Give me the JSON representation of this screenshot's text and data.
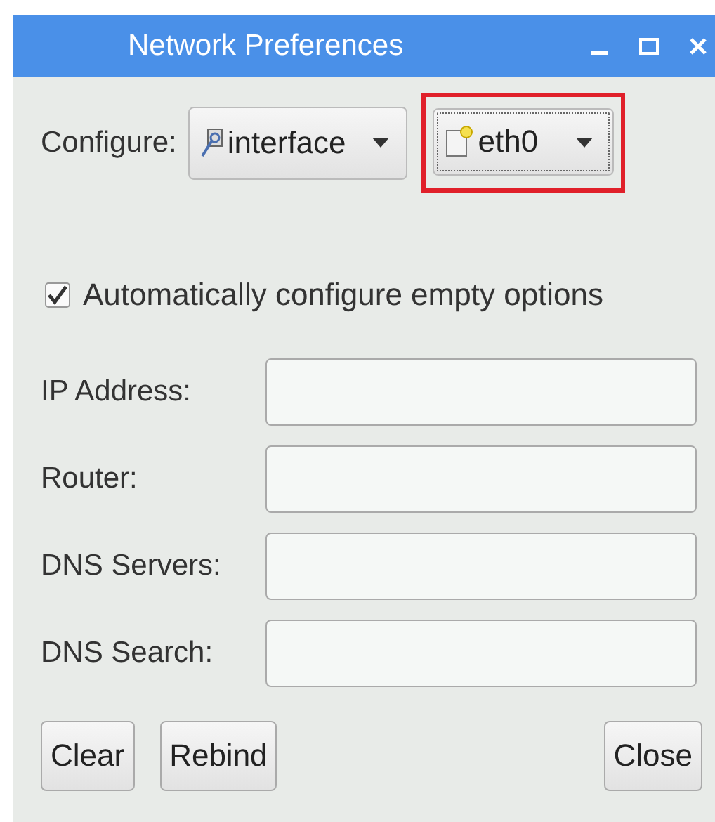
{
  "window": {
    "title": "Network Preferences"
  },
  "configure": {
    "label": "Configure:",
    "dropdowns": [
      {
        "value": "interface",
        "highlighted": false
      },
      {
        "value": "eth0",
        "highlighted": true
      }
    ]
  },
  "auto": {
    "label": "Automatically configure empty options",
    "checked": true
  },
  "fields": [
    {
      "label": "IP Address:"
    },
    {
      "label": "Router:"
    },
    {
      "label": "DNS Servers:"
    },
    {
      "label": "DNS Search:"
    }
  ],
  "buttons": [
    {
      "label": "Clear"
    },
    {
      "label": "Rebind"
    },
    {
      "label": "Close"
    }
  ]
}
